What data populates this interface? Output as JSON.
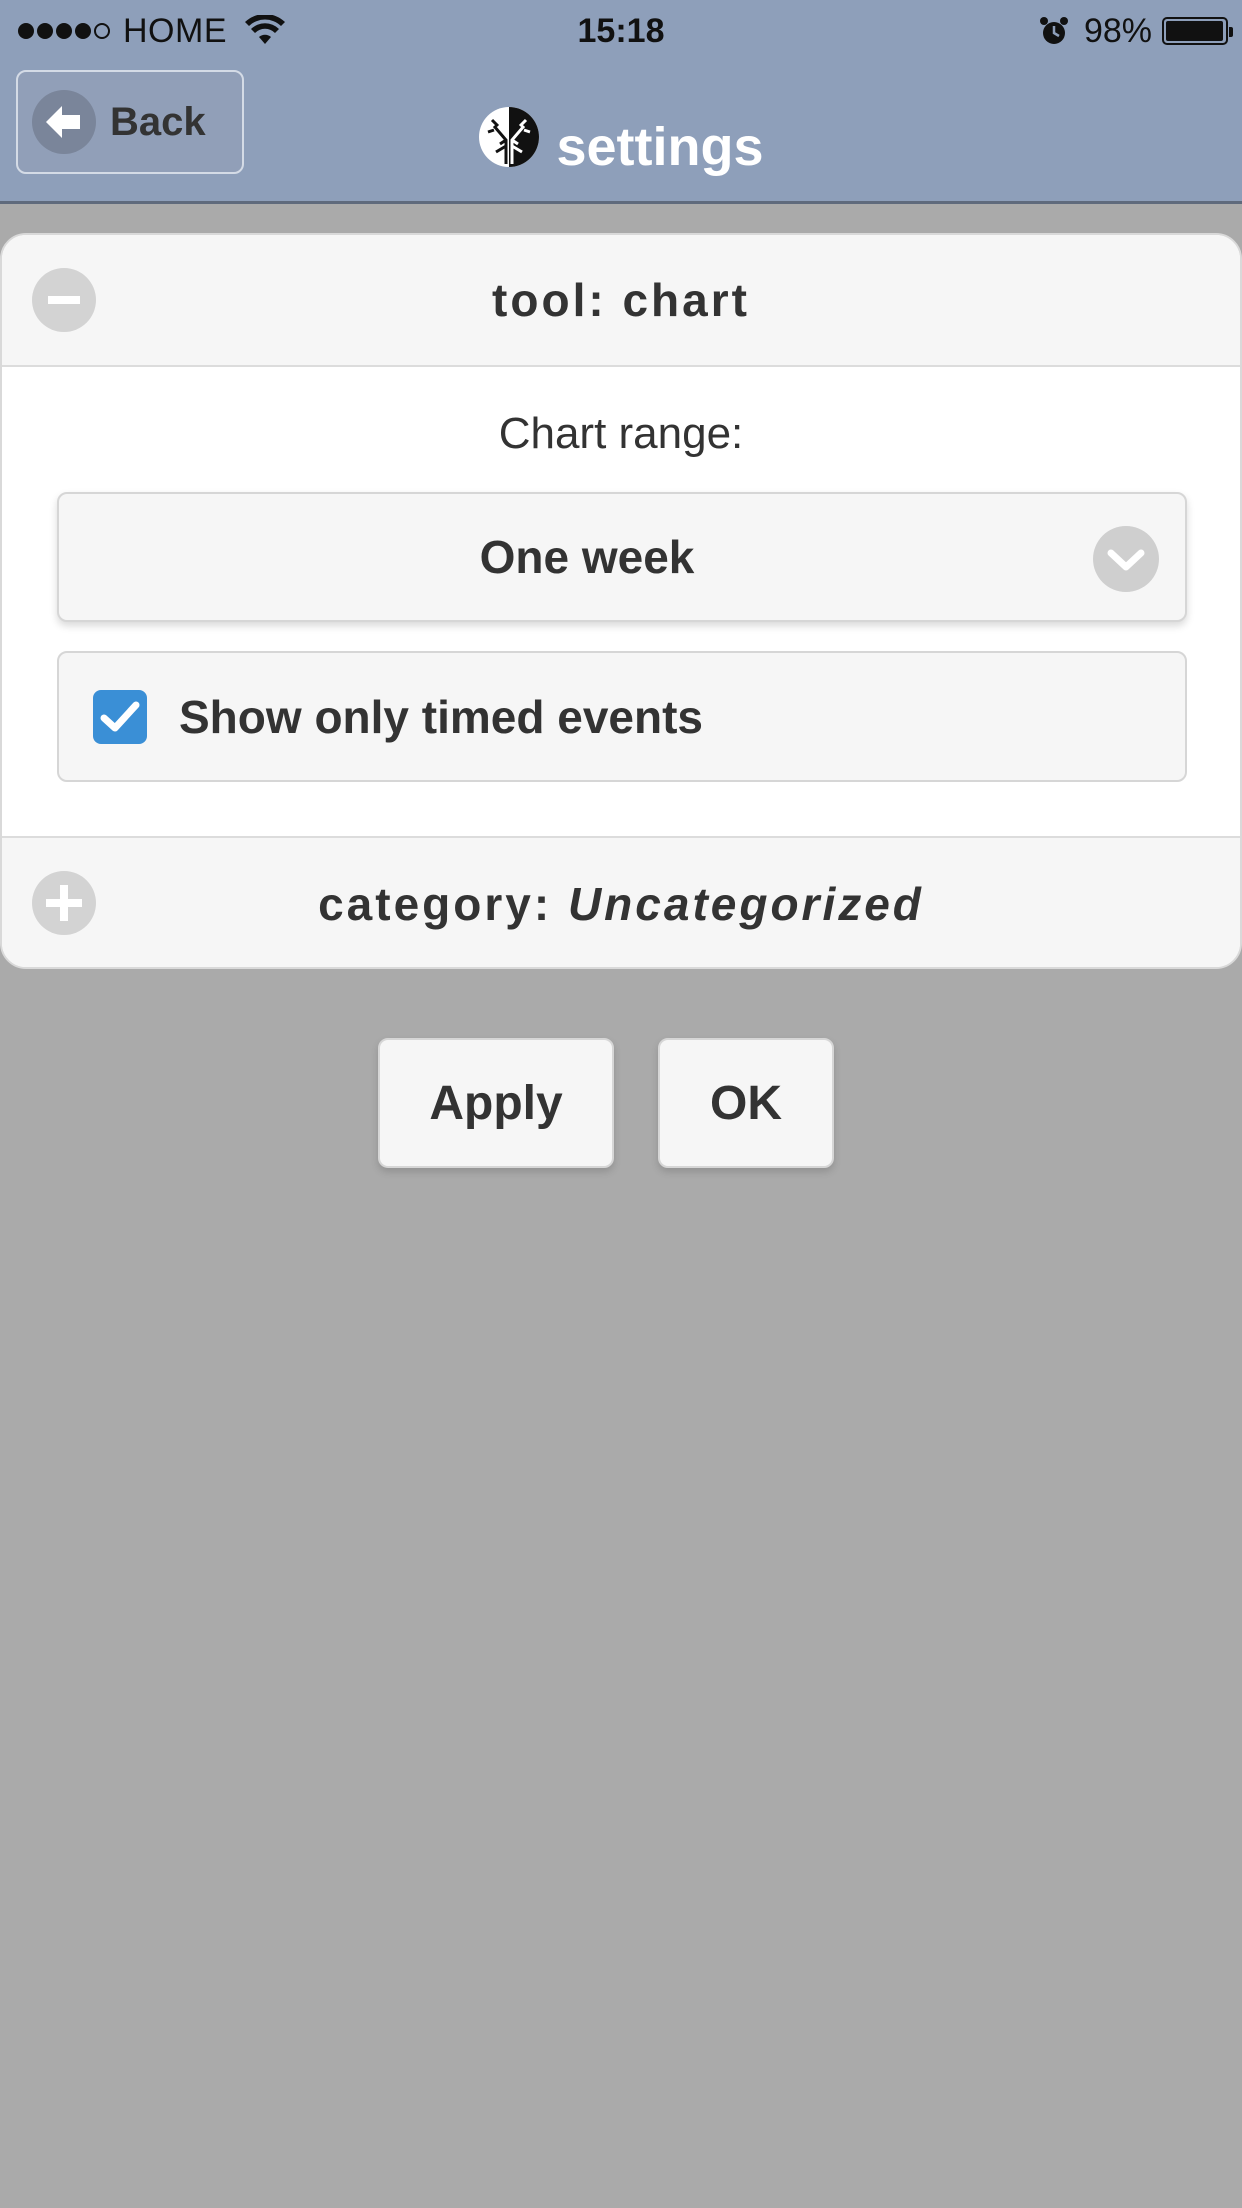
{
  "status_bar": {
    "carrier": "HOME",
    "time": "15:18",
    "battery_percent": "98%",
    "battery_level": 0.98,
    "signal_bars_filled": 4,
    "signal_bars_total": 5
  },
  "header": {
    "back_label": "Back",
    "title": "settings"
  },
  "sections": {
    "tool": {
      "prefix": "tool: ",
      "value": "chart",
      "expanded": true
    },
    "category": {
      "prefix": "category: ",
      "value": "Uncategorized",
      "expanded": false
    }
  },
  "chart_settings": {
    "range_label": "Chart range:",
    "range_value": "One week",
    "timed_events_label": "Show only timed events",
    "timed_events_checked": true
  },
  "actions": {
    "apply_label": "Apply",
    "ok_label": "OK"
  },
  "colors": {
    "header_bg": "#8e9fba",
    "page_bg": "#aaaaaa",
    "checkbox_accent": "#3a8fd6"
  },
  "icons": {
    "back": "arrow-left-icon",
    "logo": "tree-logo-icon",
    "collapse": "minus-circle-icon",
    "expand": "plus-circle-icon",
    "dropdown": "chevron-down-icon",
    "checkbox": "check-icon",
    "wifi": "wifi-icon",
    "alarm": "alarm-clock-icon",
    "battery": "battery-icon"
  }
}
